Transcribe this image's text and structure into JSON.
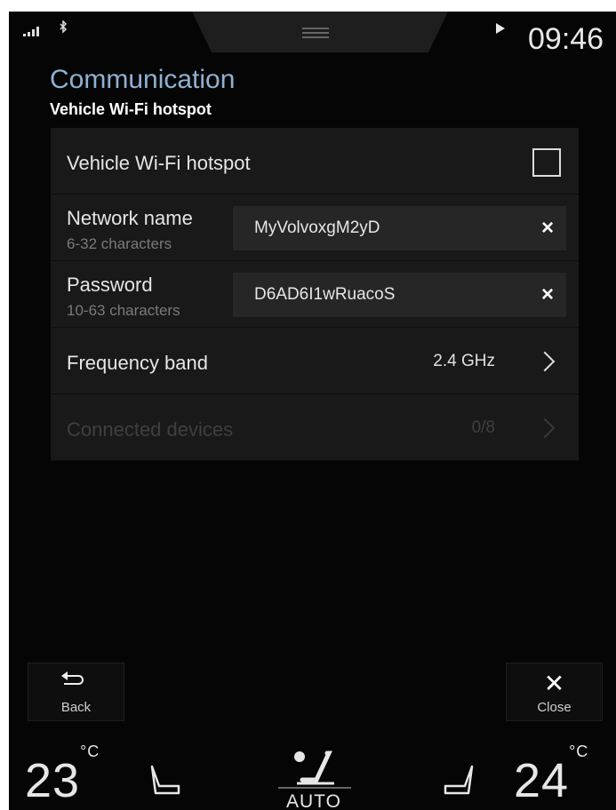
{
  "status_bar": {
    "time": "09:46",
    "signal_icon": "signal-bars-icon",
    "bluetooth_icon": "bluetooth-icon",
    "play_icon": "play-icon"
  },
  "header": {
    "title": "Communication",
    "subtitle": "Vehicle Wi-Fi hotspot"
  },
  "settings": {
    "hotspot": {
      "label": "Vehicle Wi-Fi hotspot",
      "checked": false
    },
    "network_name": {
      "label": "Network name",
      "hint": "6-32 characters",
      "value": "MyVolvoxgM2yD",
      "clear": "×"
    },
    "password": {
      "label": "Password",
      "hint": "10-63 characters",
      "value": "D6AD6I1wRuacoS",
      "clear": "×"
    },
    "frequency_band": {
      "label": "Frequency band",
      "value": "2.4 GHz"
    },
    "connected_devices": {
      "label": "Connected devices",
      "value": "0/8",
      "enabled": false
    }
  },
  "buttons": {
    "back": "Back",
    "close": "Close"
  },
  "climate": {
    "left_temp": "23",
    "right_temp": "24",
    "unit": "°C",
    "mode": "AUTO"
  },
  "colors": {
    "background": "#050505",
    "panel": "#191919",
    "title_accent": "#8fb1d2"
  }
}
